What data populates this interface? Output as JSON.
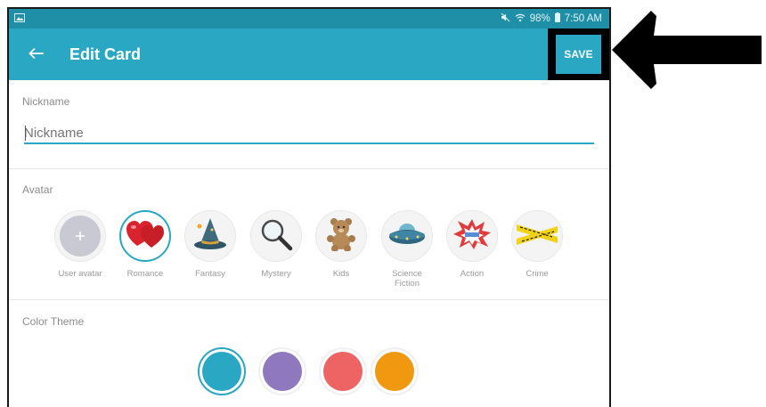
{
  "status": {
    "battery": "98%",
    "time": "7:50 AM"
  },
  "appbar": {
    "title": "Edit Card",
    "save_label": "SAVE"
  },
  "nickname": {
    "section_label": "Nickname",
    "placeholder": "Nickname",
    "value": ""
  },
  "avatar": {
    "section_label": "Avatar",
    "items": [
      {
        "label": "User avatar",
        "icon": "plus-icon"
      },
      {
        "label": "Romance",
        "icon": "hearts-icon"
      },
      {
        "label": "Fantasy",
        "icon": "wizard-hat-icon"
      },
      {
        "label": "Mystery",
        "icon": "magnifier-icon"
      },
      {
        "label": "Kids",
        "icon": "teddy-bear-icon"
      },
      {
        "label": "Science Fiction",
        "icon": "ufo-icon"
      },
      {
        "label": "Action",
        "icon": "explosion-icon"
      },
      {
        "label": "Crime",
        "icon": "crime-tape-icon"
      }
    ],
    "selected": "Romance"
  },
  "color_theme": {
    "section_label": "Color Theme",
    "colors": [
      "#2aa7c3",
      "#8f78bd",
      "#ee6464",
      "#f0980f"
    ],
    "selected_color": "#2aa7c3"
  },
  "colors": {
    "statusbar": "#1f8fa8",
    "appbar": "#2aa7c3",
    "accent": "#2aa7c3"
  }
}
